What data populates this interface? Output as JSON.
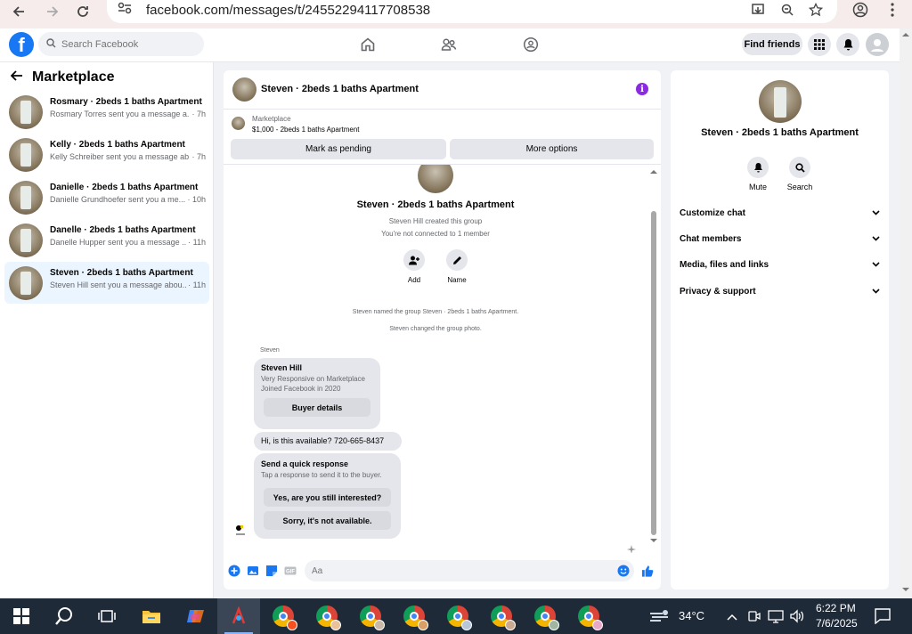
{
  "browser": {
    "url": "facebook.com/messages/t/24552294117708538"
  },
  "header": {
    "search_placeholder": "Search Facebook",
    "find_friends": "Find friends"
  },
  "sidebar": {
    "title": "Marketplace",
    "conversations": [
      {
        "name": "Rosmary · 2beds 1 baths Apartment",
        "preview": "Rosmary Torres sent you a message a...",
        "time": "· 7h"
      },
      {
        "name": "Kelly · 2beds 1 baths Apartment",
        "preview": "Kelly Schreiber sent you a message ab...",
        "time": "· 7h"
      },
      {
        "name": "Danielle · 2beds 1 baths Apartment",
        "preview": "Danielle Grundhoefer sent you a me...",
        "time": "· 10h"
      },
      {
        "name": "Danelle · 2beds 1 baths Apartment",
        "preview": "Danelle Hupper sent you a message ...",
        "time": "· 11h"
      },
      {
        "name": "Steven · 2beds 1 baths Apartment",
        "preview": "Steven Hill sent you a message abou...",
        "time": "· 11h"
      }
    ]
  },
  "chat": {
    "title": "Steven · 2beds 1 baths Apartment",
    "marketplace_label": "Marketplace",
    "listing": "$1,000 - 2beds 1 baths Apartment",
    "mark_pending": "Mark as pending",
    "more_options": "More options",
    "group_name": "Steven · 2beds 1 baths Apartment",
    "created_text": "Steven Hill created this group",
    "not_connected": "You're not connected to 1 member",
    "add_label": "Add",
    "name_label": "Name",
    "event1": "Steven named the group Steven · 2beds 1 baths Apartment.",
    "event2": "Steven changed the group photo.",
    "sender": "Steven",
    "card_name": "Steven Hill",
    "card_line1": "Very Responsive on Marketplace",
    "card_line2": "Joined Facebook in 2020",
    "buyer_details": "Buyer details",
    "message": "Hi, is this available? 720-665-8437",
    "quick_title": "Send a quick response",
    "quick_sub": "Tap a response to send it to the buyer.",
    "quick_reply1": "Yes, are you still interested?",
    "quick_reply2": "Sorry, it's not available.",
    "composer_placeholder": "Aa"
  },
  "right_panel": {
    "name": "Steven · 2beds 1 baths Apartment",
    "mute": "Mute",
    "search": "Search",
    "sections": [
      "Customize chat",
      "Chat members",
      "Media, files and links",
      "Privacy & support"
    ]
  },
  "taskbar": {
    "temperature": "34°C",
    "time": "6:22 PM",
    "date": "7/6/2025"
  },
  "colors": {
    "fb_blue": "#1877f2",
    "active_conv": "#ebf5ff",
    "info_purple": "#8a2be2"
  }
}
